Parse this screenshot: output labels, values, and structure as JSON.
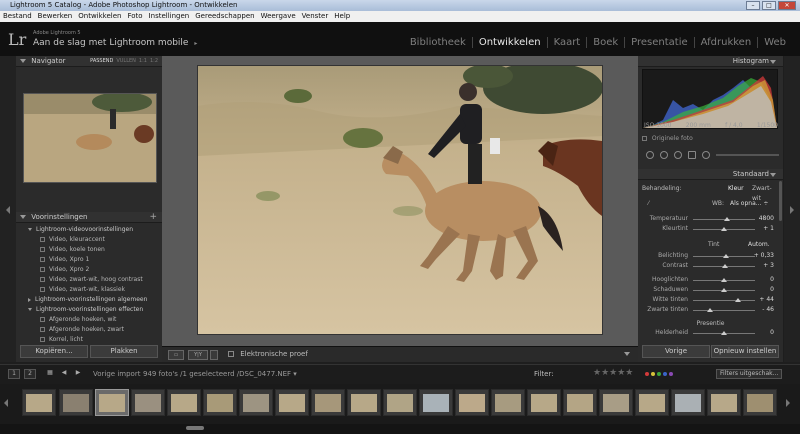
{
  "window": {
    "title": "Lightroom 5 Catalog - Adobe Photoshop Lightroom - Ontwikkelen",
    "buttons": [
      "–",
      "□",
      "✕"
    ]
  },
  "menubar": [
    "Bestand",
    "Bewerken",
    "Ontwikkelen",
    "Foto",
    "Instellingen",
    "Gereedschappen",
    "Weergave",
    "Venster",
    "Help"
  ],
  "header": {
    "logo": "Lr",
    "product": "Adobe Lightroom 5",
    "identity": "Aan de slag met Lightroom mobile",
    "identity_arrow": "▸",
    "modules": [
      "Bibliotheek",
      "Ontwikkelen",
      "Kaart",
      "Boek",
      "Presentatie",
      "Afdrukken",
      "Web"
    ],
    "active_module": "Ontwikkelen"
  },
  "navigator": {
    "title": "Navigator",
    "options": [
      "PASSEND",
      "VULLEN",
      "1:1",
      "1:2"
    ],
    "selected": "PASSEND"
  },
  "presets": {
    "title": "Voorinstellingen",
    "add": "+",
    "rows": [
      {
        "type": "folder",
        "open": true,
        "label": "Lightroom-videovoorinstellingen"
      },
      {
        "type": "item",
        "label": "Video, kleuraccent"
      },
      {
        "type": "item",
        "label": "Video, koele tonen"
      },
      {
        "type": "item",
        "label": "Video, Xpro 1"
      },
      {
        "type": "item",
        "label": "Video, Xpro 2"
      },
      {
        "type": "item",
        "label": "Video, zwart-wit, hoog contrast"
      },
      {
        "type": "item",
        "label": "Video, zwart-wit, klassiek"
      },
      {
        "type": "folder",
        "open": false,
        "label": "Lightroom-voorinstellingen algemeen"
      },
      {
        "type": "folder",
        "open": true,
        "label": "Lightroom-voorinstellingen effecten"
      },
      {
        "type": "item",
        "label": "Afgeronde hoeken, wit"
      },
      {
        "type": "item",
        "label": "Afgeronde hoeken, zwart"
      },
      {
        "type": "item",
        "label": "Korrel, licht"
      }
    ]
  },
  "left_buttons": {
    "copy": "Kopiëren...",
    "paste": "Plakken"
  },
  "toolbar": {
    "view1": "▭",
    "view2": "Y|Y",
    "proof_label": "Elektronische proef"
  },
  "histogram": {
    "title": "Histogram",
    "iso": "ISO 1000",
    "focal": "200 mm",
    "aperture": "f / 4,0",
    "shutter": "1/1500",
    "original_label": "Originele foto"
  },
  "basic": {
    "title": "Standaard",
    "treatment_label": "Behandeling:",
    "color": "Kleur",
    "bw": "Zwart-wit",
    "wb_label": "WB:",
    "wb_value": "Als opna... ÷",
    "tone_label": "Tint",
    "auto": "Autom.",
    "presence": "Presentie",
    "sliders": [
      {
        "label": "Temperatuur",
        "value": "4800",
        "pos": 0.55
      },
      {
        "label": "Kleurtint",
        "value": "+ 1",
        "pos": 0.5
      },
      {
        "label": "Belichting",
        "value": "+ 0,33",
        "pos": 0.53
      },
      {
        "label": "Contrast",
        "value": "+ 3",
        "pos": 0.52
      },
      {
        "label": "Hooglichten",
        "value": "0",
        "pos": 0.5
      },
      {
        "label": "Schaduwen",
        "value": "0",
        "pos": 0.5
      },
      {
        "label": "Witte tinten",
        "value": "+ 44",
        "pos": 0.72
      },
      {
        "label": "Zwarte tinten",
        "value": "- 46",
        "pos": 0.27
      },
      {
        "label": "Helderheid",
        "value": "0",
        "pos": 0.5
      }
    ]
  },
  "right_buttons": {
    "prev": "Vorige",
    "reset": "Opnieuw instellen"
  },
  "filmbar": {
    "page1": "1",
    "page2": "2",
    "source": "Vorige import",
    "count": "949 foto's /1 geselecteerd /DSC_0477.NEF ▾",
    "filter": "Filter:",
    "filter_select": "Filters uitgeschak...",
    "stars": "★★★★★"
  },
  "colors": {
    "label_red": "#d23a3a",
    "label_yellow": "#d6c23a",
    "label_green": "#3aa63a",
    "label_blue": "#3a64c8",
    "label_purple": "#8a4ab4"
  }
}
